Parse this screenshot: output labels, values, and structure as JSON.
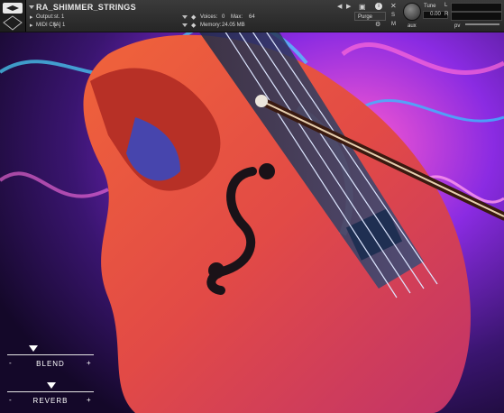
{
  "header": {
    "instrument_name": "RA_SHIMMER_STRINGS",
    "output_label": "Output:",
    "output_value": "st. 1",
    "midi_label": "MIDI Ch:",
    "midi_value": "[A] 1",
    "voices_label": "Voices:",
    "voices_value": "0",
    "max_label": "Max:",
    "max_value": "64",
    "memory_label": "Memory:",
    "memory_value": "24.05 MB",
    "purge_label": "Purge",
    "tune_label": "Tune",
    "tune_value": "0.00",
    "s_label": "S",
    "m_label": "M",
    "aux_label": "aux",
    "pv_label": "pv",
    "l_label": "L",
    "r_label": "R"
  },
  "controls": {
    "blend": {
      "label": "BLEND",
      "minus": "-",
      "plus": "+"
    },
    "reverb": {
      "label": "REVERB",
      "minus": "-",
      "plus": "+"
    }
  },
  "colors": {
    "accent_pink": "#e040a8",
    "accent_blue": "#2fb8ff",
    "violin_body": "#d8482c"
  }
}
